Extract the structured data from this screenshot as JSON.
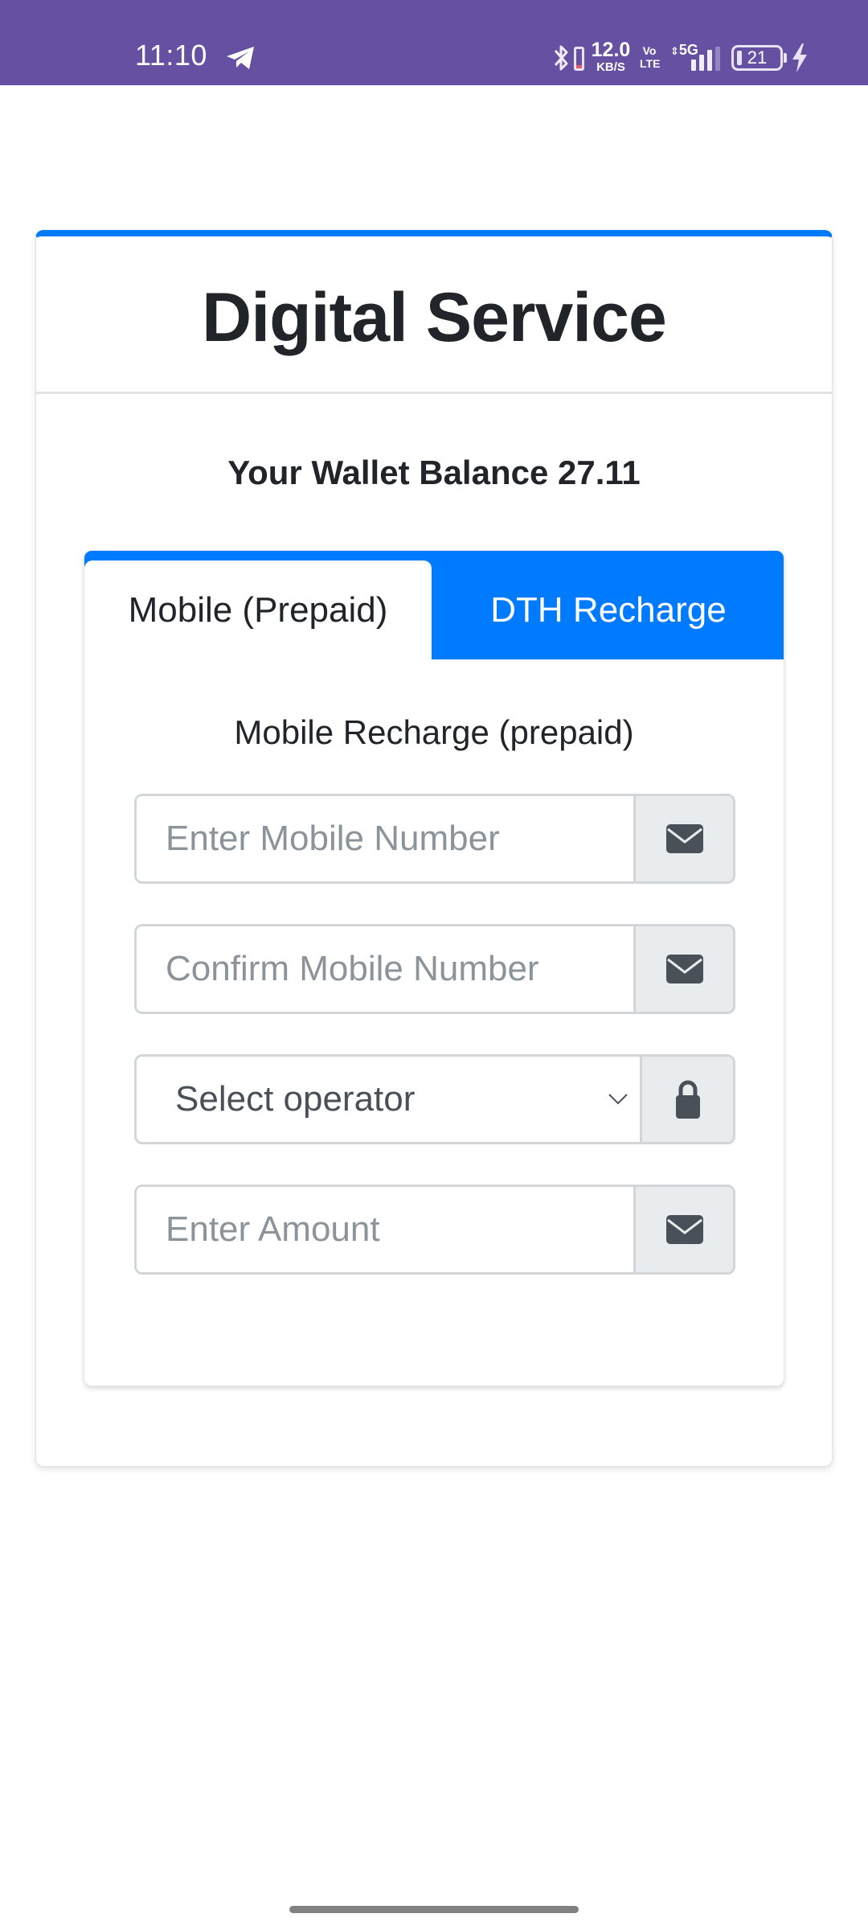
{
  "status_bar": {
    "time": "11:10",
    "notification_icon": "telegram-icon",
    "bluetooth_icon": "bluetooth-icon",
    "net_speed_value": "12.0",
    "net_speed_unit": "KB/S",
    "volte_top": "Vo",
    "volte_bottom": "LTE",
    "network_type": "5G",
    "battery_level": "21",
    "charging_icon": "bolt-icon"
  },
  "header": {
    "title": "Digital Service"
  },
  "wallet": {
    "label": "Your Wallet Balance",
    "balance": "27.11",
    "text": "Your Wallet Balance 27.11"
  },
  "tabs": [
    {
      "label": "Mobile (Prepaid)",
      "active": true
    },
    {
      "label": "DTH Recharge",
      "active": false
    }
  ],
  "form": {
    "section_title": "Mobile Recharge (prepaid)",
    "fields": [
      {
        "type": "input",
        "value": "",
        "placeholder": "Enter Mobile Number",
        "icon": "envelope-icon"
      },
      {
        "type": "input",
        "value": "",
        "placeholder": "Confirm Mobile Number",
        "icon": "envelope-icon"
      },
      {
        "type": "select",
        "selected": "Select operator",
        "icon": "lock-icon"
      },
      {
        "type": "input",
        "value": "",
        "placeholder": "Enter Amount",
        "icon": "envelope-icon"
      }
    ]
  },
  "colors": {
    "status_bar": "#6650a2",
    "primary": "#007bff",
    "text": "#212529",
    "placeholder": "#8c949b",
    "addon_bg": "#e9ecef",
    "icon": "#495057"
  }
}
